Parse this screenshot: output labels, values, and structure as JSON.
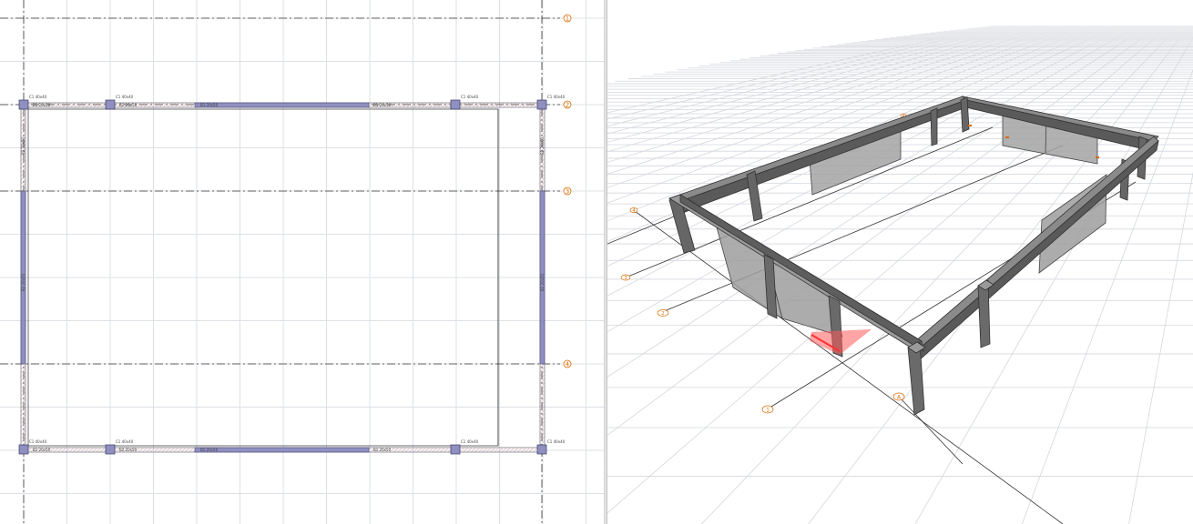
{
  "app": {
    "panes": [
      "2D floor plan",
      "3D model view"
    ]
  },
  "plan": {
    "grid_bubbles": [
      {
        "label": "1"
      },
      {
        "label": "2"
      },
      {
        "label": "3"
      },
      {
        "label": "4"
      }
    ],
    "beam_tags": {
      "top": [
        "B1 20x50",
        "B2 20x50",
        "B1 20x50",
        "B1 20x50"
      ],
      "bottom": [
        "B1 20x50",
        "B2 20x50",
        "B1 20x50",
        "B1 20x50"
      ],
      "left": [
        "B2 20x50",
        "B2 20x50"
      ],
      "right": [
        "B2 20x50",
        "B2 20x50"
      ]
    },
    "column_tags": [
      "C1 40x40",
      "C1 40x40",
      "C1 40x40",
      "C1 40x40",
      "C1 40x40",
      "C1 40x40",
      "C1 40x40",
      "C1 40x40"
    ]
  },
  "view3d": {
    "grid_bubbles": [
      {
        "label": "4"
      },
      {
        "label": "3"
      },
      {
        "label": "2"
      },
      {
        "label": "1"
      },
      {
        "label": "A"
      },
      {
        "label": "B"
      }
    ],
    "colors": {
      "frame": "#555555",
      "wall": "#9e9e9e",
      "grid": "#d4d7dd",
      "selection": "#ff5a5a"
    }
  }
}
